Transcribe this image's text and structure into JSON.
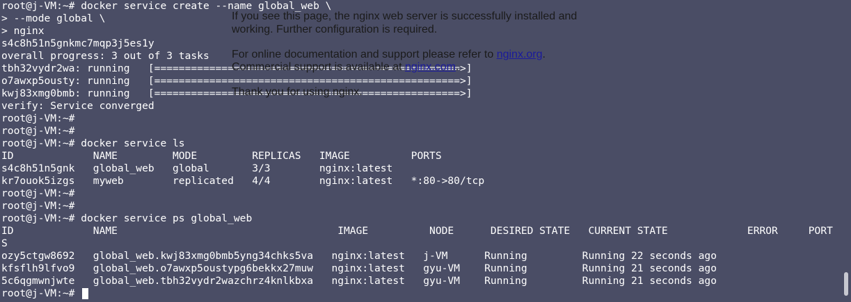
{
  "terminal": {
    "lines": [
      "root@j-VM:~# docker service create --name global_web \\",
      "> --mode global \\",
      "> nginx",
      "s4c8h51n5gnkmc7mqp3j5es1y",
      "overall progress: 3 out of 3 tasks",
      "tbh32vydr2wa: running   [==================================================>]",
      "o7awxp5ousty: running   [==================================================>]",
      "kwj83xmg0bmb: running   [==================================================>]",
      "verify: Service converged",
      "root@j-VM:~#",
      "root@j-VM:~#",
      "root@j-VM:~# docker service ls",
      "ID             NAME         MODE         REPLICAS   IMAGE          PORTS",
      "s4c8h51n5gnk   global_web   global       3/3        nginx:latest",
      "kr7ouok5izgs   myweb        replicated   4/4        nginx:latest   *:80->80/tcp",
      "root@j-VM:~#",
      "root@j-VM:~#",
      "root@j-VM:~# docker service ps global_web",
      "ID             NAME                                    IMAGE          NODE      DESIRED STATE   CURRENT STATE             ERROR     PORT",
      "S",
      "ozy5ctgw8692   global_web.kwj83xmg0bmb5yng34chks5va   nginx:latest   j-VM      Running         Running 22 seconds ago",
      "kfsflh9lfvo9   global_web.o7awxp5oustypg6bekkx27muw   nginx:latest   gyu-VM    Running         Running 21 seconds ago",
      "5c6qgmwnjwte   global_web.tbh32vydr2wazchrz4knlkbxa   nginx:latest   gyu-VM    Running         Running 21 seconds ago",
      "root@j-VM:~# "
    ]
  },
  "nginx_overlay": {
    "line1": "If you see this page, the nginx web server is successfully installed and",
    "line2": "working. Further configuration is required.",
    "line3_prefix": "For online documentation and support please refer to ",
    "line3_link": "nginx.org",
    "line3_suffix": ".",
    "line4_prefix": "Commercial support is available at ",
    "line4_link": "nginx.com",
    "line4_suffix": ".",
    "line5": "Thank you for using nginx."
  }
}
